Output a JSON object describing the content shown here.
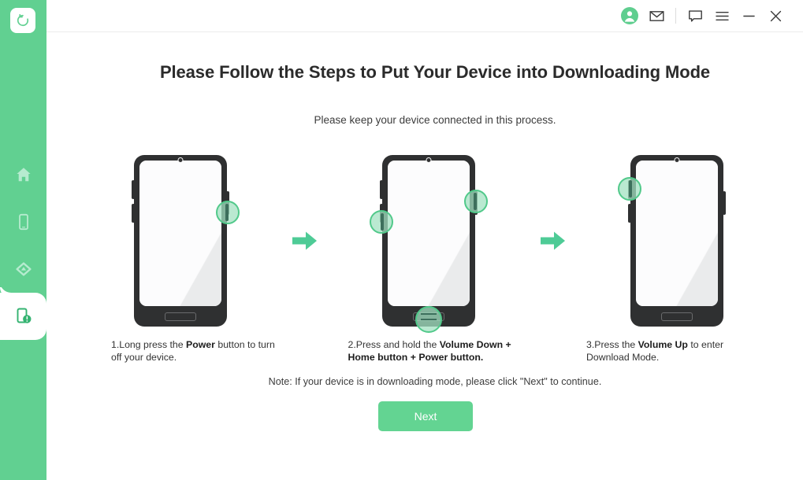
{
  "theme": {
    "accent": "#61d091",
    "accent_button": "#63d492",
    "highlight_fill": "#a3e2c1",
    "highlight_ring": "#51c98a",
    "phone_body": "#2f3031",
    "screen": "#f2f3f4",
    "text": "#333333"
  },
  "sidebar": {
    "logo": {
      "icon": "restore-circular-arrow-icon"
    },
    "items": [
      {
        "icon": "home-icon",
        "name": "home",
        "active": false
      },
      {
        "icon": "phone-icon",
        "name": "device",
        "active": false
      },
      {
        "icon": "cloud-backup-icon",
        "name": "backup",
        "active": false
      },
      {
        "icon": "phone-repair-icon",
        "name": "system-repair",
        "active": true
      }
    ]
  },
  "titlebar": {
    "buttons": [
      {
        "icon": "user-avatar-icon",
        "name": "account"
      },
      {
        "icon": "mail-icon",
        "name": "mail"
      },
      {
        "icon": "divider",
        "name": "divider"
      },
      {
        "icon": "feedback-bubble-icon",
        "name": "feedback"
      },
      {
        "icon": "hamburger-menu-icon",
        "name": "menu"
      },
      {
        "icon": "minimize-icon",
        "name": "minimize"
      },
      {
        "icon": "close-icon",
        "name": "close"
      }
    ]
  },
  "main": {
    "title": "Please Follow the Steps to Put Your Device into Downloading Mode",
    "subtitle": "Please keep your device connected in this process.",
    "note": "Note: If your device is in downloading mode, please click \"Next\" to continue.",
    "next_label": "Next",
    "arrow_icon": "arrow-right-icon",
    "steps": [
      {
        "number": "1",
        "caption_parts": [
          {
            "text": "1.Long press the ",
            "bold": false
          },
          {
            "text": "Power",
            "bold": true
          },
          {
            "text": " button to turn off your device.",
            "bold": false
          }
        ],
        "highlights": [
          "power-right"
        ]
      },
      {
        "number": "2",
        "caption_parts": [
          {
            "text": "2.Press and hold the ",
            "bold": false
          },
          {
            "text": "Volume Down",
            "bold": true
          },
          {
            "text": " ",
            "bold": false
          },
          {
            "text": "+ Home button + Power button.",
            "bold": true
          }
        ],
        "highlights": [
          "volume-left",
          "power-right",
          "home-bottom"
        ]
      },
      {
        "number": "3",
        "caption_parts": [
          {
            "text": "3.Press the ",
            "bold": false
          },
          {
            "text": "Volume Up",
            "bold": true
          },
          {
            "text": " to enter Download Mode.",
            "bold": false
          }
        ],
        "highlights": [
          "volume-up-left"
        ]
      }
    ]
  }
}
